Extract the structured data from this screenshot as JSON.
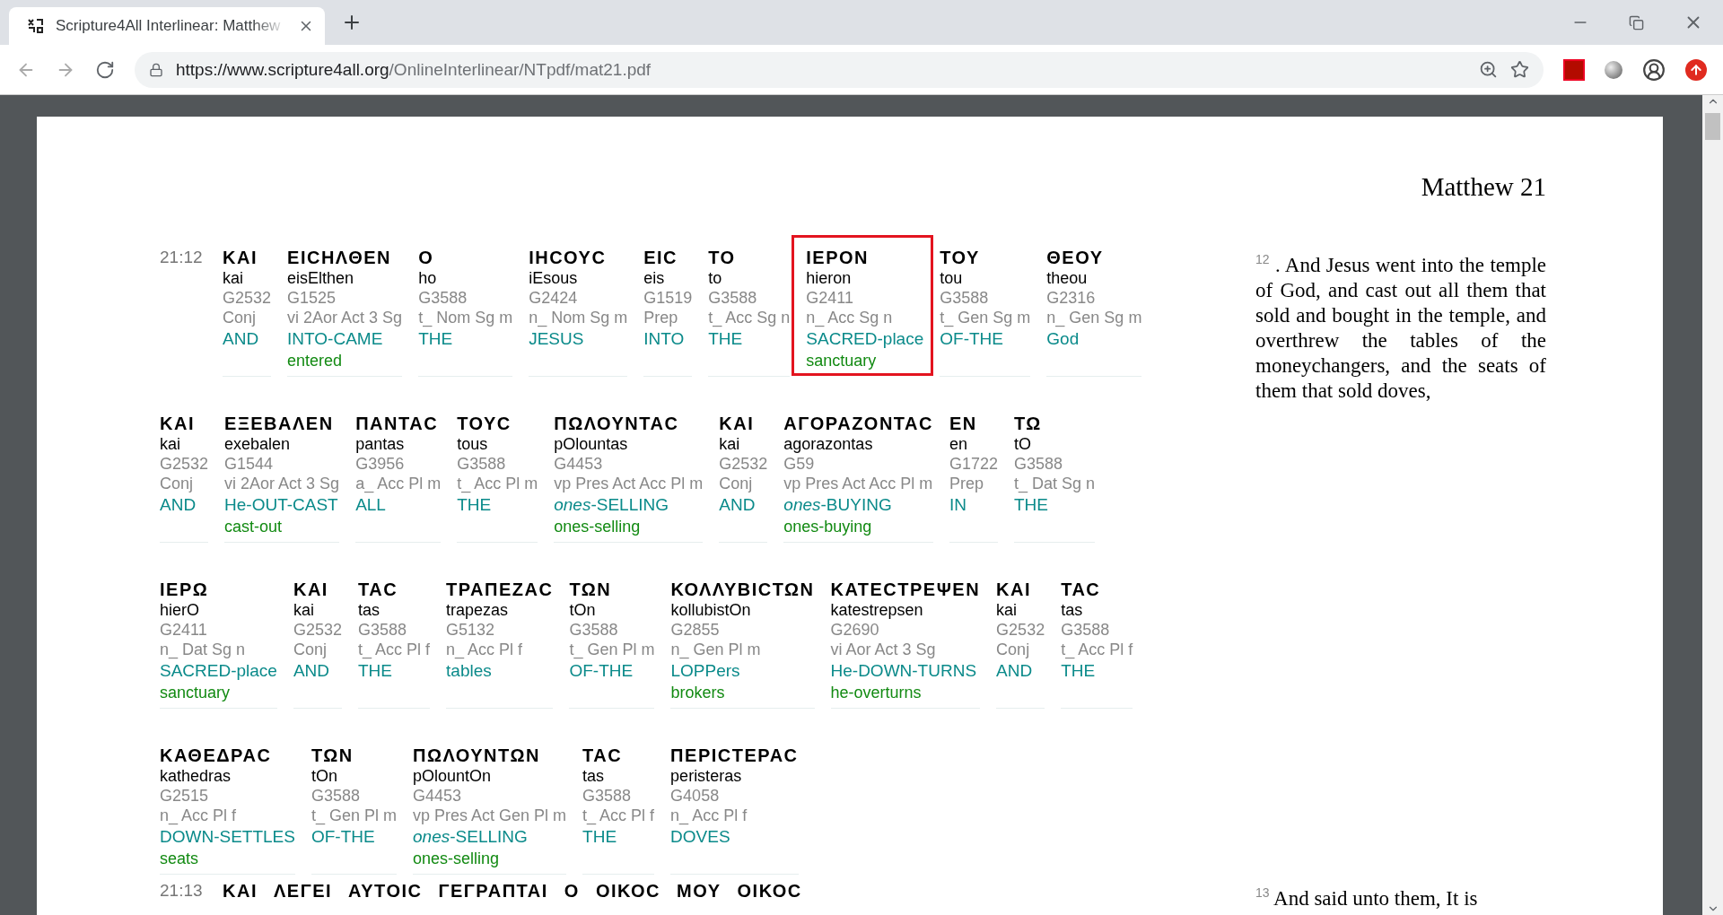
{
  "browser": {
    "tab": {
      "title": "Scripture4All Interlinear: Matthew",
      "selected": true
    },
    "url_host": "https://www.scripture4all.org",
    "url_path": "/OnlineInterlinear/NTpdf/mat21.pdf"
  },
  "page": {
    "title": "Matthew 21",
    "verses": [
      {
        "number": "21:12",
        "text": "$^{12}$ . And Jesus went into the temple of God, and cast out all them that sold and bought in the temple, and overthrew the tables of the moneychangers, and the seats of them that sold doves,",
        "lines": [
          [
            {
              "greek": "ΚΑΙ",
              "translit": "kai",
              "strong": "G2532",
              "parse": "Conj",
              "gloss": "AND",
              "highlighted": false
            },
            {
              "greek": "ΕΙϹΗΛΘΕΝ",
              "translit": "eisElthen",
              "strong": "G1525",
              "parse": "vi 2Aor Act 3 Sg",
              "gloss": "INTO-CAME",
              "meaning": "entered",
              "highlighted": false
            },
            {
              "greek": "Ο",
              "translit": "ho",
              "strong": "G3588",
              "parse": "t_ Nom Sg m",
              "gloss": "THE",
              "highlighted": false
            },
            {
              "greek": "ΙΗϹΟΥϹ",
              "translit": "iEsous",
              "strong": "G2424",
              "parse": "n_ Nom Sg m",
              "gloss": "JESUS",
              "highlighted": false
            },
            {
              "greek": "ΕΙϹ",
              "translit": "eis",
              "strong": "G1519",
              "parse": "Prep",
              "gloss": "INTO",
              "highlighted": false
            },
            {
              "greek": "ΤΟ",
              "translit": "to",
              "strong": "G3588",
              "parse": "t_ Acc Sg n",
              "gloss": "THE",
              "highlighted": false
            },
            {
              "greek": "ΙΕΡΟΝ",
              "translit": "hieron",
              "strong": "G2411",
              "parse": "n_ Acc Sg n",
              "gloss": "SACRED-place",
              "meaning": "sanctuary",
              "highlighted": true
            },
            {
              "greek": "ΤΟΥ",
              "translit": "tou",
              "strong": "G3588",
              "parse": "t_ Gen Sg m",
              "gloss": "OF-THE",
              "highlighted": false
            },
            {
              "greek": "ΘΕΟΥ",
              "translit": "theou",
              "strong": "G2316",
              "parse": "n_ Gen Sg m",
              "gloss": "God",
              "highlighted": false
            }
          ],
          [
            {
              "greek": "ΚΑΙ",
              "translit": "kai",
              "strong": "G2532",
              "parse": "Conj",
              "gloss": "AND",
              "highlighted": false
            },
            {
              "greek": "ΕΞΕΒΑΛΕΝ",
              "translit": "exebalen",
              "strong": "G1544",
              "parse": "vi 2Aor Act 3 Sg",
              "gloss": "He-OUT-CAST",
              "meaning": "cast-out",
              "highlighted": false
            },
            {
              "greek": "ΠΑΝΤΑϹ",
              "translit": "pantas",
              "strong": "G3956",
              "parse": "a_ Acc Pl m",
              "gloss": "ALL",
              "highlighted": false
            },
            {
              "greek": "ΤΟΥϹ",
              "translit": "tous",
              "strong": "G3588",
              "parse": "t_ Acc Pl m",
              "gloss": "THE",
              "highlighted": false
            },
            {
              "greek": "ΠΩΛΟΥΝΤΑϹ",
              "translit": "pOlountas",
              "strong": "G4453",
              "parse": "vp Pres Act Acc Pl m",
              "gloss": "*ones*-SELLING",
              "meaning": "ones-selling",
              "highlighted": false
            },
            {
              "greek": "ΚΑΙ",
              "translit": "kai",
              "strong": "G2532",
              "parse": "Conj",
              "gloss": "AND",
              "highlighted": false
            },
            {
              "greek": "ΑΓΟΡΑΖΟΝΤΑϹ",
              "translit": "agorazontas",
              "strong": "G59",
              "parse": "vp Pres Act Acc Pl m",
              "gloss": "*ones*-BUYING",
              "meaning": "ones-buying",
              "highlighted": false
            },
            {
              "greek": "ΕΝ",
              "translit": "en",
              "strong": "G1722",
              "parse": "Prep",
              "gloss": "IN",
              "highlighted": false
            },
            {
              "greek": "ΤΩ",
              "translit": "tO",
              "strong": "G3588",
              "parse": "t_ Dat Sg n",
              "gloss": "THE",
              "highlighted": false
            }
          ],
          [
            {
              "greek": "ΙΕΡΩ",
              "translit": "hierO",
              "strong": "G2411",
              "parse": "n_ Dat Sg n",
              "gloss": "SACRED-place",
              "meaning": "sanctuary",
              "highlighted": false
            },
            {
              "greek": "ΚΑΙ",
              "translit": "kai",
              "strong": "G2532",
              "parse": "Conj",
              "gloss": "AND",
              "highlighted": false
            },
            {
              "greek": "ΤΑϹ",
              "translit": "tas",
              "strong": "G3588",
              "parse": "t_ Acc Pl f",
              "gloss": "THE",
              "highlighted": false
            },
            {
              "greek": "ΤΡΑΠΕΖΑϹ",
              "translit": "trapezas",
              "strong": "G5132",
              "parse": "n_ Acc Pl f",
              "gloss": "tables",
              "highlighted": false
            },
            {
              "greek": "ΤΩΝ",
              "translit": "tOn",
              "strong": "G3588",
              "parse": "t_ Gen Pl m",
              "gloss": "OF-THE",
              "highlighted": false
            },
            {
              "greek": "ΚΟΛΛΥΒΙϹΤΩΝ",
              "translit": "kollubistOn",
              "strong": "G2855",
              "parse": "n_ Gen Pl m",
              "gloss": "LOPPers",
              "meaning": "brokers",
              "highlighted": false
            },
            {
              "greek": "ΚΑΤΕϹΤΡΕΨΕΝ",
              "translit": "katestrepsen",
              "strong": "G2690",
              "parse": "vi Aor Act 3 Sg",
              "gloss": "He-DOWN-TURNS",
              "meaning": "he-overturns",
              "highlighted": false
            },
            {
              "greek": "ΚΑΙ",
              "translit": "kai",
              "strong": "G2532",
              "parse": "Conj",
              "gloss": "AND",
              "highlighted": false
            },
            {
              "greek": "ΤΑϹ",
              "translit": "tas",
              "strong": "G3588",
              "parse": "t_ Acc Pl f",
              "gloss": "THE",
              "highlighted": false
            }
          ],
          [
            {
              "greek": "ΚΑΘΕΔΡΑϹ",
              "translit": "kathedras",
              "strong": "G2515",
              "parse": "n_ Acc Pl f",
              "gloss": "DOWN-SETTLES",
              "meaning": "seats",
              "highlighted": false
            },
            {
              "greek": "ΤΩΝ",
              "translit": "tOn",
              "strong": "G3588",
              "parse": "t_ Gen Pl m",
              "gloss": "OF-THE",
              "highlighted": false
            },
            {
              "greek": "ΠΩΛΟΥΝΤΩΝ",
              "translit": "pOlountOn",
              "strong": "G4453",
              "parse": "vp Pres Act Gen Pl m",
              "gloss": "*ones*-SELLING",
              "meaning": "ones-selling",
              "highlighted": false
            },
            {
              "greek": "ΤΑϹ",
              "translit": "tas",
              "strong": "G3588",
              "parse": "t_ Acc Pl f",
              "gloss": "THE",
              "highlighted": false
            },
            {
              "greek": "ΠΕΡΙϹΤΕΡΑϹ",
              "translit": "peristeras",
              "strong": "G4058",
              "parse": "n_ Acc Pl f",
              "gloss": "DOVES",
              "highlighted": false
            }
          ]
        ]
      },
      {
        "number": "21:13",
        "text": "$^{13}$ And said unto them, It is",
        "lines": [
          [
            {
              "greek": "ΚΑΙ"
            },
            {
              "greek": "ΛΕΓΕΙ"
            },
            {
              "greek": "ΑΥΤΟΙϹ"
            },
            {
              "greek": "ΓΕΓΡΑΠΤΑΙ"
            },
            {
              "greek": "Ο"
            },
            {
              "greek": "ΟΙΚΟϹ"
            },
            {
              "greek": "ΜΟΥ"
            },
            {
              "greek": "ΟΙΚΟϹ"
            }
          ]
        ]
      }
    ]
  }
}
